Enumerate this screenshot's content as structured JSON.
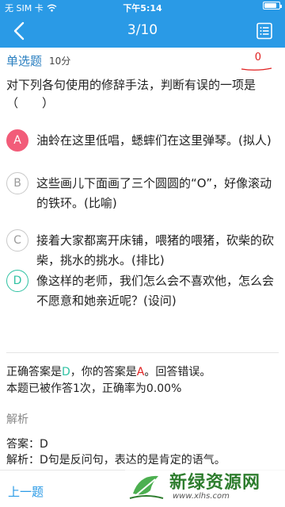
{
  "status_bar": {
    "carrier": "无 SIM 卡",
    "time": "下午5:14",
    "battery_level": 0.85
  },
  "nav": {
    "title": "3/10",
    "back_icon": "chevron-left-icon",
    "menu_icon": "list-icon"
  },
  "question": {
    "type": "单选题",
    "points": "10分",
    "score": "0",
    "stem": "对下列各句使用的修辞手法，判断有误的一项是（　　）"
  },
  "options": [
    {
      "letter": "A",
      "text": "油蛉在这里低唱，蟋蟀们在这里弹琴。(拟人)",
      "state": "selected"
    },
    {
      "letter": "B",
      "text": "这些画儿下面画了三个圆圆的“O”，好像滚动的铁环。(比喻)",
      "state": "normal"
    },
    {
      "letter": "C",
      "text": "接着大家都离开床铺，喂猪的喂猪，砍柴的砍柴，挑水的挑水。(排比)",
      "state": "normal"
    },
    {
      "letter": "D",
      "text": "像这样的老师，我们怎么会不喜欢他，怎么会不愿意和她亲近呢？(设问)",
      "state": "correct"
    }
  ],
  "result": {
    "correct_prefix": "正确答案是",
    "correct_answer": "D",
    "your_prefix": "，你的答案是",
    "your_answer": "A",
    "verdict": "。回答错误。",
    "stats": "本题已被作答1次，正确率为0.00%"
  },
  "analysis": {
    "title": "解析",
    "answer_line": "答案：D",
    "explanation_line": "解析：D句是反问句，表达的是肯定的语气。"
  },
  "bottom": {
    "prev_label": "上一题"
  },
  "watermark": {
    "title": "新绿资源网",
    "url": "www.xlhs.com"
  },
  "colors": {
    "accent": "#2a9ae6",
    "correct": "#2fc2a3",
    "wrong": "#e02020",
    "selected": "#f25c79"
  }
}
